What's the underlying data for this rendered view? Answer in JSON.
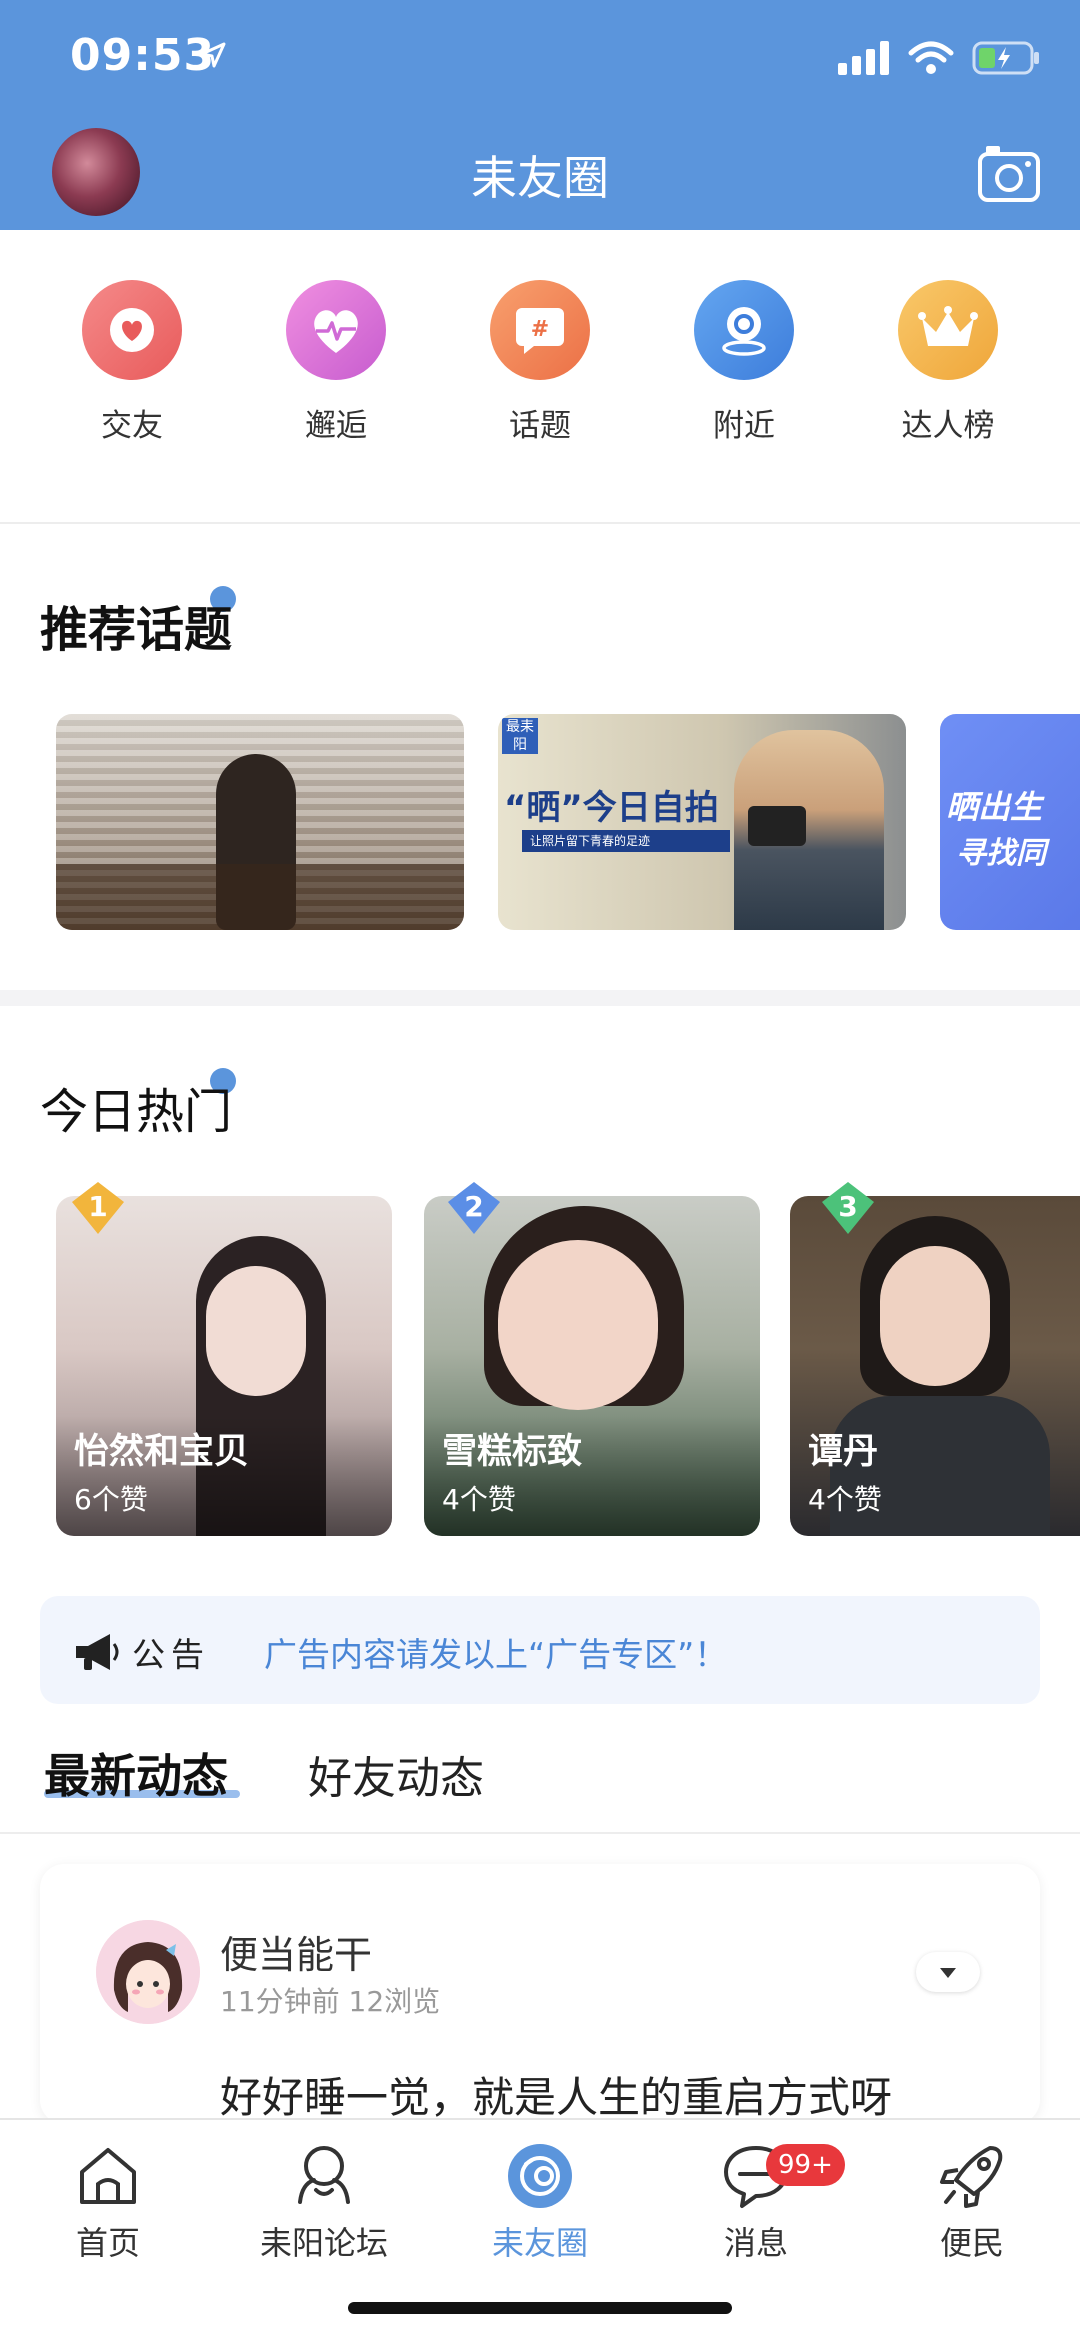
{
  "status": {
    "time": "09:53"
  },
  "header": {
    "title": "耒友圈"
  },
  "quick_menu": [
    {
      "label": "交友",
      "icon": "heart-icon",
      "color": "#ee6b6b"
    },
    {
      "label": "邂逅",
      "icon": "heartbeat-icon",
      "color": "#d86bd8"
    },
    {
      "label": "话题",
      "icon": "hashtag-icon",
      "color": "#f0855a"
    },
    {
      "label": "附近",
      "icon": "location-icon",
      "color": "#4a8de0"
    },
    {
      "label": "达人榜",
      "icon": "crown-icon",
      "color": "#f3b54e"
    }
  ],
  "recommend": {
    "title": "推荐话题",
    "cards": [
      {
        "text": ""
      },
      {
        "text": "“晒”今日自拍",
        "sub": "让照片留下青春的足迹",
        "tag": "最耒阳"
      },
      {
        "text": "晒出生",
        "text2": "寻找同"
      }
    ]
  },
  "hot": {
    "title": "今日热门",
    "items": [
      {
        "rank": "1",
        "name": "怡然和宝贝",
        "likes": "6个赞",
        "rank_color": "#f2b53c"
      },
      {
        "rank": "2",
        "name": "雪糕标致",
        "likes": "4个赞",
        "rank_color": "#5b8ee6"
      },
      {
        "rank": "3",
        "name": "谭丹",
        "likes": "4个赞",
        "rank_color": "#4cc27a"
      }
    ]
  },
  "notice": {
    "label": "公告",
    "text": "广告内容请发以上“广告专区”！"
  },
  "feed_tabs": {
    "latest": "最新动态",
    "friends": "好友动态"
  },
  "post": {
    "user": "便当能干",
    "meta": "11分钟前  12浏览",
    "text": "好好睡一觉，就是人生的重启方式呀"
  },
  "tabbar": {
    "items": [
      {
        "label": "首页",
        "icon": "home-icon"
      },
      {
        "label": "耒阳论坛",
        "icon": "forum-icon"
      },
      {
        "label": "耒友圈",
        "icon": "circle-icon",
        "active": true
      },
      {
        "label": "消息",
        "icon": "message-icon",
        "badge": "99+"
      },
      {
        "label": "便民",
        "icon": "rocket-icon"
      }
    ],
    "active_color": "#5b95dc"
  }
}
